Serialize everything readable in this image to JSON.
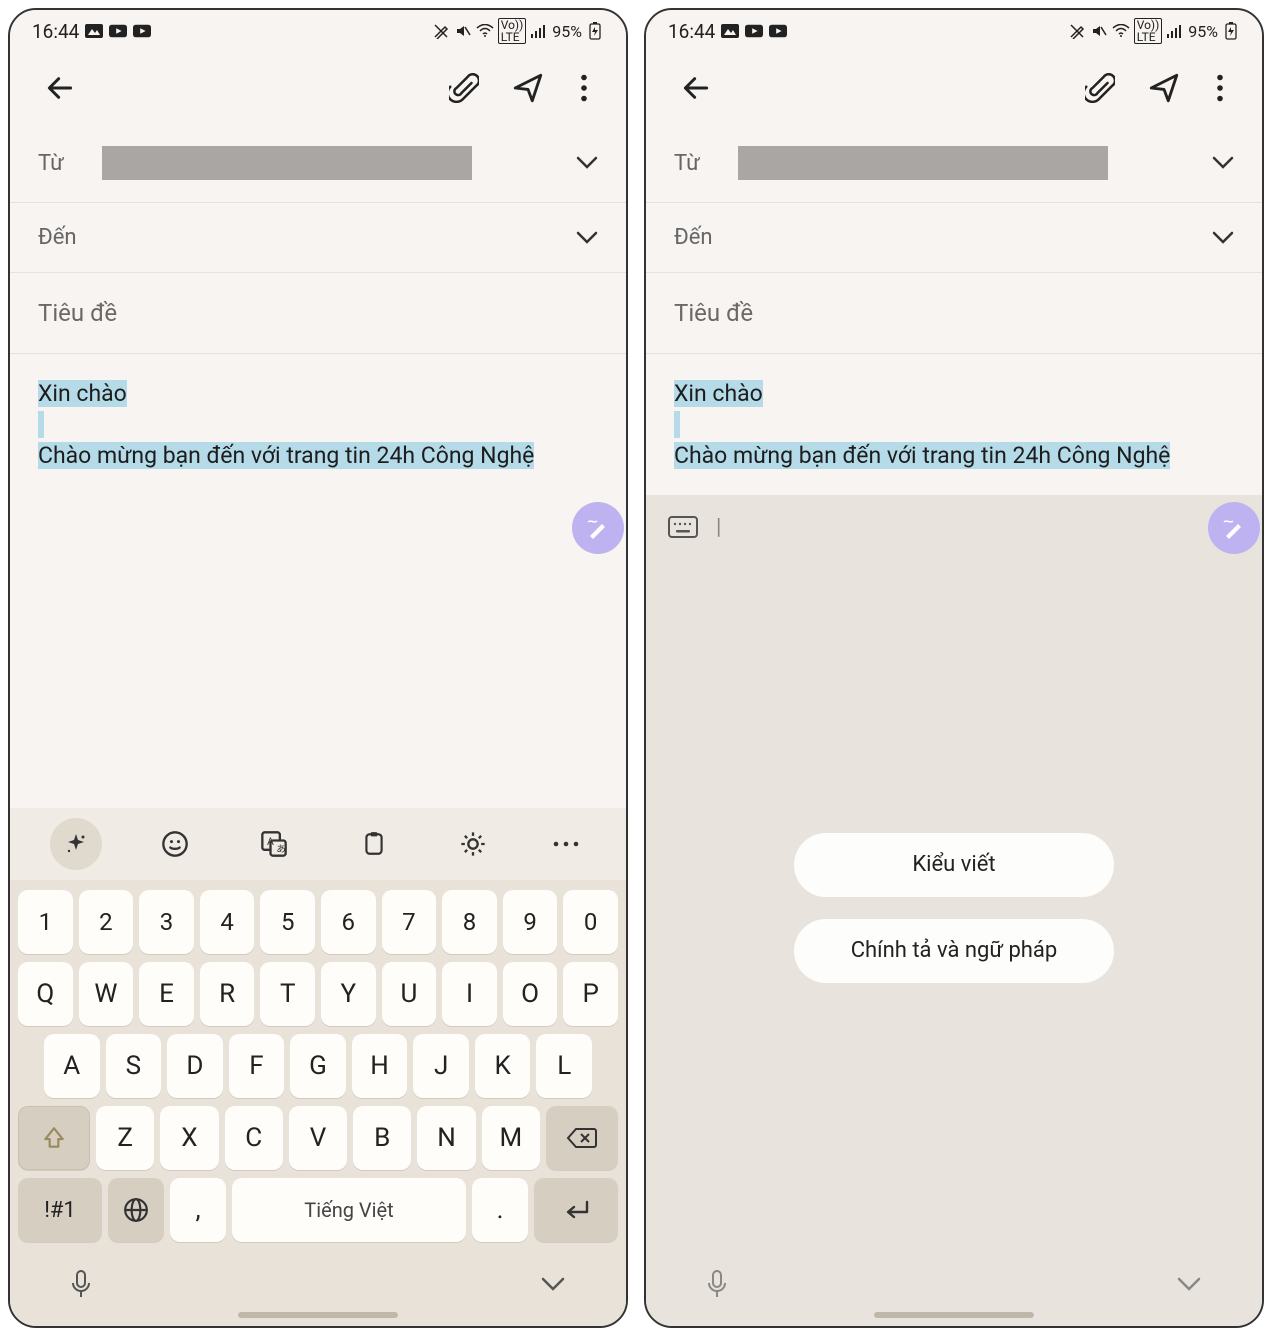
{
  "status": {
    "time": "16:44",
    "battery": "95%"
  },
  "compose": {
    "from_label": "Từ",
    "to_label": "Đến",
    "subject_placeholder": "Tiêu đề",
    "body_line1": "Xin chào",
    "body_line2": "Chào mừng bạn đến với trang tin 24h Công Nghệ"
  },
  "keyboard": {
    "row_num": [
      "1",
      "2",
      "3",
      "4",
      "5",
      "6",
      "7",
      "8",
      "9",
      "0"
    ],
    "row_q": [
      "Q",
      "W",
      "E",
      "R",
      "T",
      "Y",
      "U",
      "I",
      "O",
      "P"
    ],
    "row_a": [
      "A",
      "S",
      "D",
      "F",
      "G",
      "H",
      "J",
      "K",
      "L"
    ],
    "row_z": [
      "Z",
      "X",
      "C",
      "V",
      "B",
      "N",
      "M"
    ],
    "sym": "!#1",
    "comma": ",",
    "space_label": "Tiếng Việt",
    "period": "."
  },
  "suggest": {
    "cursor": "|",
    "option1": "Kiểu viết",
    "option2": "Chính tả và ngữ pháp"
  }
}
